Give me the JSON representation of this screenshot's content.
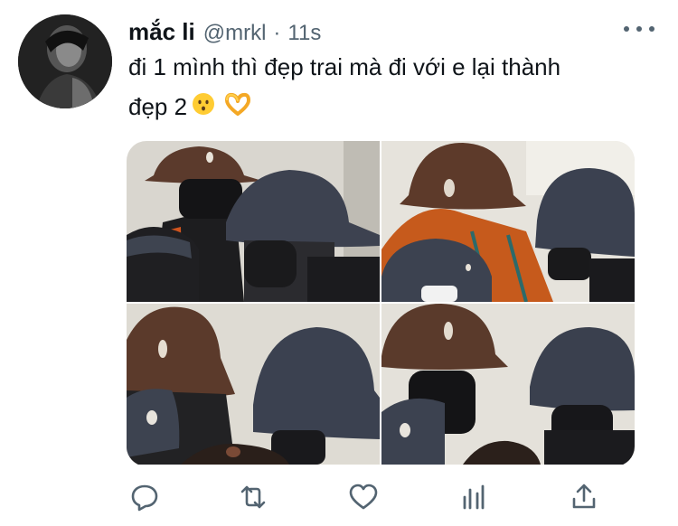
{
  "tweet": {
    "author_name": "mắc li",
    "author_handle": "@mrkl",
    "separator": "·",
    "timestamp": "11s",
    "text_line1": "đi 1 mình thì đẹp trai mà đi với e lại thành",
    "text_line2": "đẹp 2",
    "emojis": [
      "kissing-face-icon",
      "heart-hands-icon"
    ]
  },
  "media": {
    "photo_count": 4
  },
  "actions": {
    "icons": [
      "reply-icon",
      "retweet-icon",
      "like-icon",
      "analytics-icon",
      "share-icon"
    ]
  },
  "colors": {
    "text_primary": "#0f1419",
    "text_secondary": "#536471",
    "icon_gray": "#536471"
  }
}
